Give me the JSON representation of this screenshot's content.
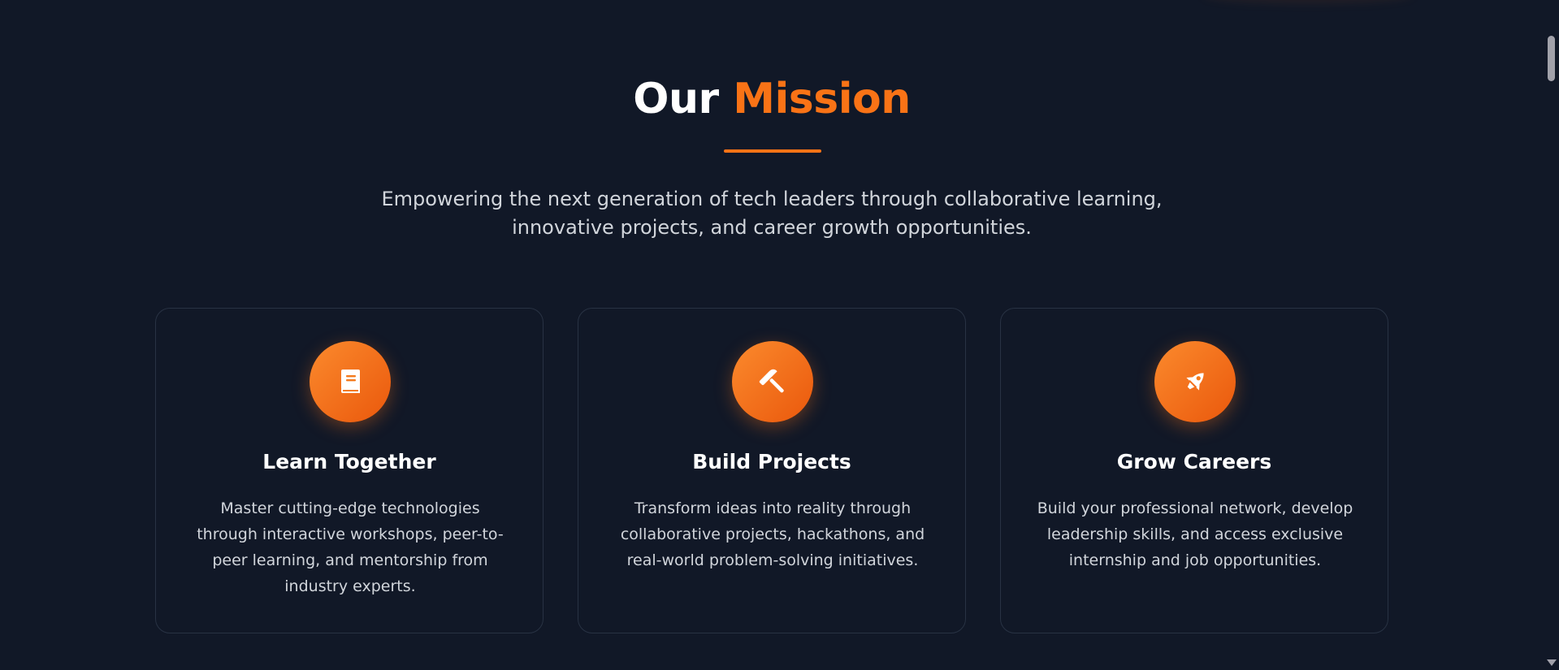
{
  "mission": {
    "title_plain": "Our",
    "title_accent": "Mission",
    "subtitle": "Empowering the next generation of tech leaders through collaborative learning, innovative projects, and career growth opportunities."
  },
  "cards": [
    {
      "icon": "book-icon",
      "title": "Learn Together",
      "text": "Master cutting-edge technologies through interactive workshops, peer-to-peer learning, and mentorship from industry experts."
    },
    {
      "icon": "hammer-icon",
      "title": "Build Projects",
      "text": "Transform ideas into reality through collaborative projects, hackathons, and real-world problem-solving initiatives."
    },
    {
      "icon": "rocket-icon",
      "title": "Grow Careers",
      "text": "Build your professional network, develop leadership skills, and access exclusive internship and job opportunities."
    }
  ],
  "colors": {
    "background": "#111827",
    "accent": "#f97316",
    "card_border": "#283243",
    "body_text": "#d1d5db"
  }
}
